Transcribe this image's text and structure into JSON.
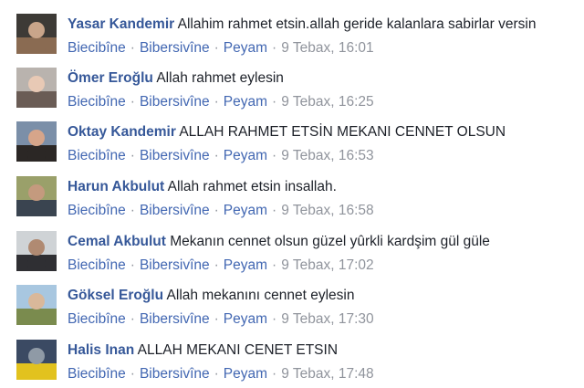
{
  "comments": [
    {
      "author": "Yasar Kandemir",
      "text": "Allahim rahmet etsin.allah geride kalanlara sabirlar versin",
      "like": "Biecibîne",
      "unlike": "Bibersivîne",
      "reply": "Peyam",
      "time": "9 Tebax, 16:01",
      "avatar_colors": [
        "#3d3a36",
        "#8a6b52",
        "#c9a58a"
      ]
    },
    {
      "author": "Ömer Eroğlu",
      "text": "Allah rahmet eylesin",
      "like": "Biecibîne",
      "unlike": "Bibersivîne",
      "reply": "Peyam",
      "time": "9 Tebax, 16:25",
      "avatar_colors": [
        "#b9b3ae",
        "#6a5c55",
        "#e8c9b5"
      ]
    },
    {
      "author": "Oktay Kandemir",
      "text": "ALLAH RAHMET ETSİN MEKANI CENNET OLSUN",
      "like": "Biecibîne",
      "unlike": "Bibersivîne",
      "reply": "Peyam",
      "time": "9 Tebax, 16:53",
      "avatar_colors": [
        "#7b8fa8",
        "#2b2725",
        "#d6a58a"
      ]
    },
    {
      "author": "Harun Akbulut",
      "text": "Allah rahmet etsin insallah.",
      "like": "Biecibîne",
      "unlike": "Bibersivîne",
      "reply": "Peyam",
      "time": "9 Tebax, 16:58",
      "avatar_colors": [
        "#9aa06a",
        "#3a4450",
        "#c49a7e"
      ]
    },
    {
      "author": "Cemal Akbulut",
      "text": "Mekanın cennet olsun güzel yûrkli kardşim gül güle",
      "like": "Biecibîne",
      "unlike": "Bibersivîne",
      "reply": "Peyam",
      "time": "9 Tebax, 17:02",
      "avatar_colors": [
        "#cfd3d6",
        "#2f2f33",
        "#b08a72"
      ]
    },
    {
      "author": "Göksel Eroğlu",
      "text": "Allah mekanını cennet eylesin",
      "like": "Biecibîne",
      "unlike": "Bibersivîne",
      "reply": "Peyam",
      "time": "9 Tebax, 17:30",
      "avatar_colors": [
        "#a8c7e0",
        "#7a8b4e",
        "#d9b89a"
      ]
    },
    {
      "author": "Halis Inan",
      "text": "ALLAH MEKANI CENET ETSIN",
      "like": "Biecibîne",
      "unlike": "Bibersivîne",
      "reply": "Peyam",
      "time": "9 Tebax, 17:48",
      "avatar_colors": [
        "#3b4a63",
        "#e2c21e",
        "#8f9aa6"
      ]
    }
  ]
}
